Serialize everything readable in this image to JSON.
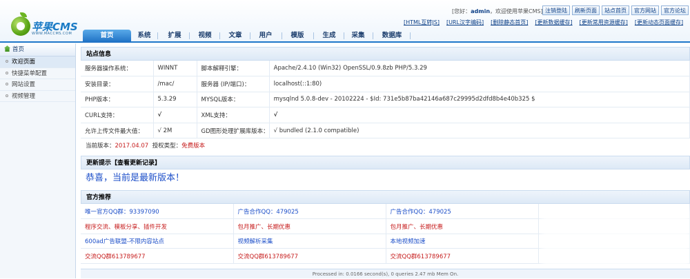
{
  "header": {
    "logo_brand": "苹果CMS",
    "logo_url": "WWW.MACCMS.COM",
    "greeting_prefix": "[您好：",
    "greeting_user": "admin",
    "greeting_suffix": "，欢迎使用苹果CMS]",
    "top_buttons": [
      "注销登陆",
      "刷新页面",
      "站点首页",
      "官方网站",
      "官方论坛"
    ],
    "links": [
      "[HTML互转JS]",
      "[URL汉字编码]",
      "[删除静态首页]",
      "[更新数据缓存]",
      "[更新常用资源缓存]",
      "[更新动态页面缓存]"
    ]
  },
  "nav": {
    "tabs": [
      "首页",
      "系统",
      "扩展",
      "视频",
      "文章",
      "用户",
      "模版",
      "生成",
      "采集",
      "数据库"
    ]
  },
  "sidebar": {
    "title": "首页",
    "items": [
      "欢迎页面",
      "快捷菜单配置",
      "网站设置",
      "视频管理"
    ]
  },
  "site_info": {
    "title": "站点信息",
    "rows": [
      [
        "服务器操作系统：",
        "WINNT",
        "脚本解释引擎：",
        "Apache/2.4.10 (Win32) OpenSSL/0.9.8zb PHP/5.3.29"
      ],
      [
        "安装目录：",
        "/mac/",
        "服务器 (IP/端口)：",
        "localhost(::1:80)"
      ],
      [
        "PHP版本：",
        "5.3.29",
        "MYSQL版本：",
        "mysqlnd 5.0.8-dev - 20102224 - $Id: 731e5b87ba42146a687c29995d2dfd8b4e40b325 $"
      ],
      [
        "CURL支持：",
        "√",
        "XML支持：",
        "√"
      ],
      [
        "允许上传文件最大值：",
        "√ 2M",
        "GD图形处理扩展库版本：",
        "√ bundled (2.1.0 compatible)"
      ]
    ],
    "version_label": "当前版本：",
    "version_value": "2017.04.07",
    "license_label": "授权类型：",
    "license_value": "免费版本"
  },
  "update": {
    "title": "更新提示",
    "title_link": "【查看更新记录】",
    "message": "恭喜，当前是最新版本！"
  },
  "recommend": {
    "title": "官方推荐",
    "rows": [
      [
        "唯一官方QQ群：93397090",
        "广告合作QQ：479025",
        "广告合作QQ：479025"
      ],
      [
        "程序交流、模板分享、插件开发",
        "包月推广、长期优惠",
        "包月推广、长期优惠"
      ],
      [
        "600ad广告联盟-不限内容站点",
        "视频解析采集",
        "本地视频加速"
      ],
      [
        "交流QQ群613789677",
        "交流QQ群613789677",
        "交流QQ群613789677"
      ]
    ]
  },
  "footer": {
    "text": "Processed in: 0.0166 second(s), 0 queries 2.47 mb Mem On."
  },
  "colors": {
    "accent": "#1e77c9",
    "link": "#1d4fc9",
    "red": "#c61c1c",
    "check": "#1a9d1a"
  }
}
